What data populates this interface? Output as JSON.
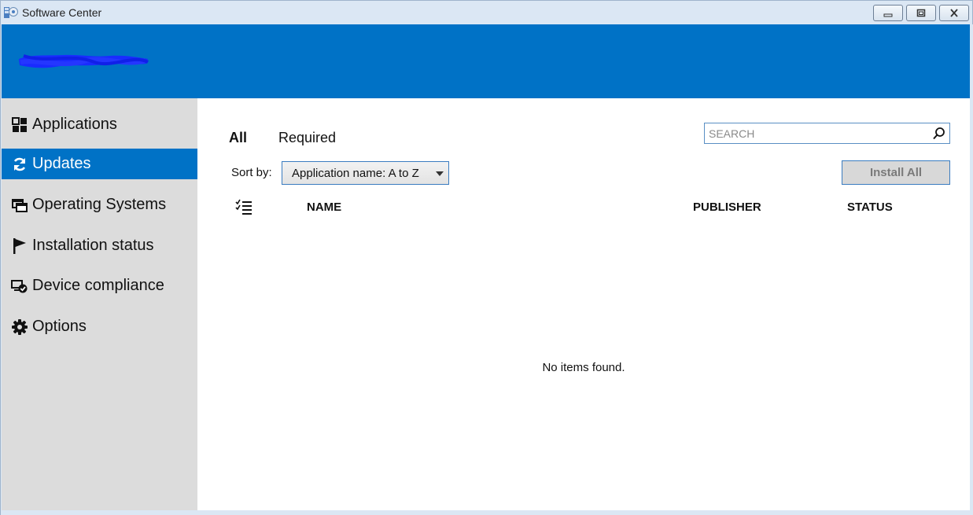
{
  "window": {
    "title": "Software Center"
  },
  "sidebar": {
    "items": [
      {
        "label": "Applications",
        "icon": "applications-icon",
        "selected": false
      },
      {
        "label": "Updates",
        "icon": "refresh-icon",
        "selected": true
      },
      {
        "label": "Operating Systems",
        "icon": "windows-icon",
        "selected": false
      },
      {
        "label": "Installation status",
        "icon": "flag-icon",
        "selected": false
      },
      {
        "label": "Device compliance",
        "icon": "device-compliance-icon",
        "selected": false
      },
      {
        "label": "Options",
        "icon": "gear-icon",
        "selected": false
      }
    ]
  },
  "main": {
    "tabs": [
      {
        "label": "All",
        "active": true
      },
      {
        "label": "Required",
        "active": false
      }
    ],
    "search": {
      "placeholder": "SEARCH",
      "value": ""
    },
    "sort": {
      "label": "Sort by:",
      "selected": "Application name: A to Z"
    },
    "install_all_label": "Install All",
    "columns": {
      "name": "NAME",
      "publisher": "PUBLISHER",
      "status": "STATUS"
    },
    "empty_message": "No items found."
  },
  "colors": {
    "accent": "#0072c6",
    "sidebar_bg": "#dcdcdc",
    "chrome_bg": "#dbe7f4",
    "redaction": "#1a2bff"
  }
}
